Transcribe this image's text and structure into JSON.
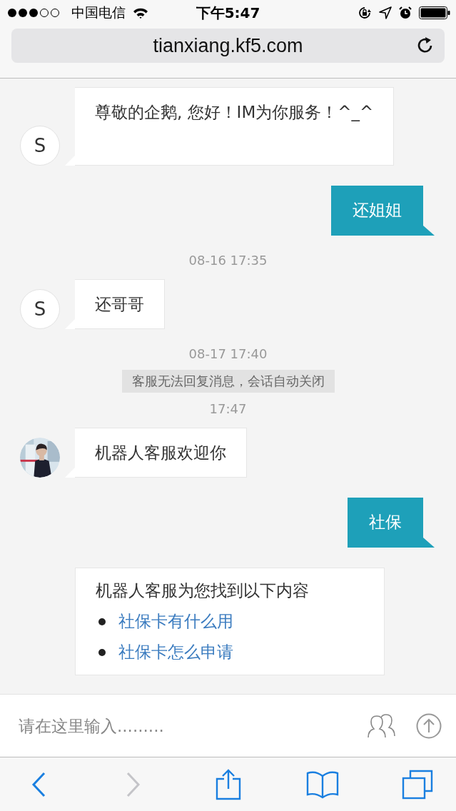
{
  "status_bar": {
    "carrier": "中国电信",
    "time": "下午5:47"
  },
  "address_bar": {
    "url": "tianxiang.kf5.com"
  },
  "messages": [
    {
      "kind": "agent",
      "avatar": {
        "kind": "letter",
        "text": "S"
      },
      "text": "尊敬的企鹅, 您好！IM为你服务！^_^"
    },
    {
      "kind": "user",
      "text": "还姐姐"
    },
    {
      "kind": "time",
      "text": "08-16 17:35"
    },
    {
      "kind": "agent",
      "avatar": {
        "kind": "letter",
        "text": "S"
      },
      "text": "还哥哥"
    },
    {
      "kind": "time",
      "text": "08-17 17:40"
    },
    {
      "kind": "notice",
      "text": "客服无法回复消息，会话自动关闭"
    },
    {
      "kind": "time",
      "text": "17:47"
    },
    {
      "kind": "agent",
      "text": "机器人客服欢迎你"
    },
    {
      "kind": "user",
      "text": "社保"
    },
    {
      "kind": "results",
      "text": "机器人客服为您找到以下内容",
      "links": [
        "社保卡有什么用",
        "社保卡怎么申请"
      ]
    }
  ],
  "input": {
    "placeholder": "请在这里输入........."
  },
  "toolbar": [
    {
      "kind": "back",
      "disabled": false
    },
    {
      "kind": "forward",
      "disabled": true
    },
    {
      "kind": "share",
      "disabled": false
    },
    {
      "kind": "bookmarks",
      "disabled": false
    },
    {
      "kind": "tabs",
      "disabled": false
    }
  ]
}
